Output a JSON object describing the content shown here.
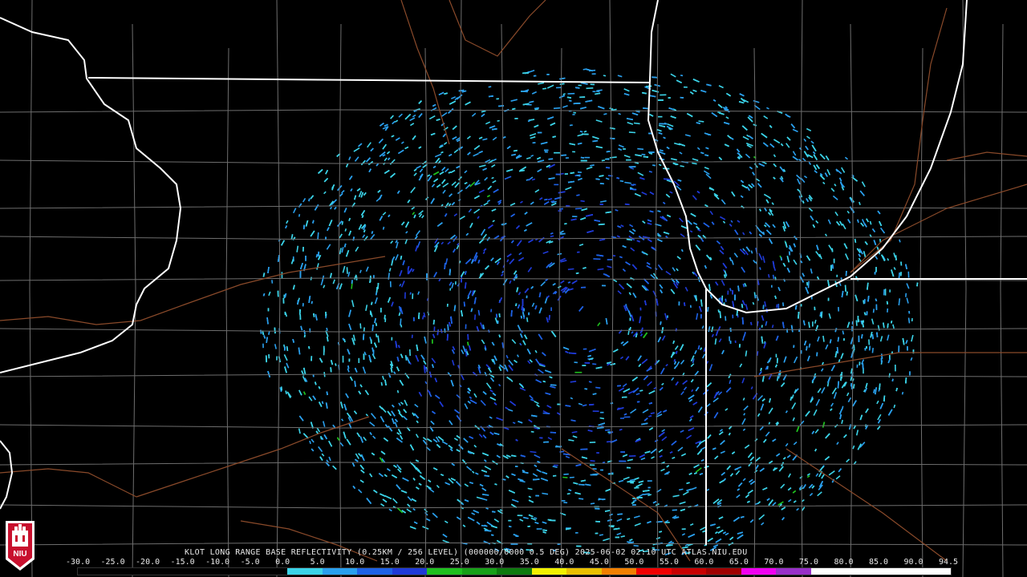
{
  "product": {
    "title": "KLOT LONG RANGE BASE REFLECTIVITY (0.25KM / 256 LEVEL) (000000/0000 0.5 DEG) 2025-06-02 02:10 UTC  ATLAS.NIU.EDU"
  },
  "logo": {
    "text": "NIU",
    "background_color": "#c8102e"
  },
  "colorbar": {
    "labels": [
      "-30.0",
      "-25.0",
      "-20.0",
      "-15.0",
      "-10.0",
      "-5.0",
      "0.0",
      "5.0",
      "10.0",
      "15.0",
      "20.0",
      "25.0",
      "30.0",
      "35.0",
      "40.0",
      "45.0",
      "50.0",
      "55.0",
      "60.0",
      "65.0",
      "70.0",
      "75.0",
      "80.0",
      "85.0",
      "90.0",
      "94.5"
    ],
    "colors": [
      "#000000",
      "#000000",
      "#000000",
      "#000000",
      "#000000",
      "#000000",
      "#3bd3e8",
      "#2aa0ee",
      "#1e62e6",
      "#1f3ad8",
      "#1fc01f",
      "#18a018",
      "#0e7a0e",
      "#f0f000",
      "#e8c000",
      "#f08000",
      "#f00000",
      "#c80000",
      "#a00000",
      "#f000f0",
      "#9830c8",
      "#ffffff",
      "#ffffff",
      "#ffffff",
      "#ffffff"
    ]
  },
  "map": {
    "background": "#000000",
    "county_line_color": "#6e6e6e",
    "state_line_color": "#ffffff",
    "highway_color": "#8a4a2a",
    "echo_colors": [
      "#3bd3e8",
      "#2aa0ee",
      "#1e62e6",
      "#1f3ad8",
      "#1fc01f"
    ]
  }
}
